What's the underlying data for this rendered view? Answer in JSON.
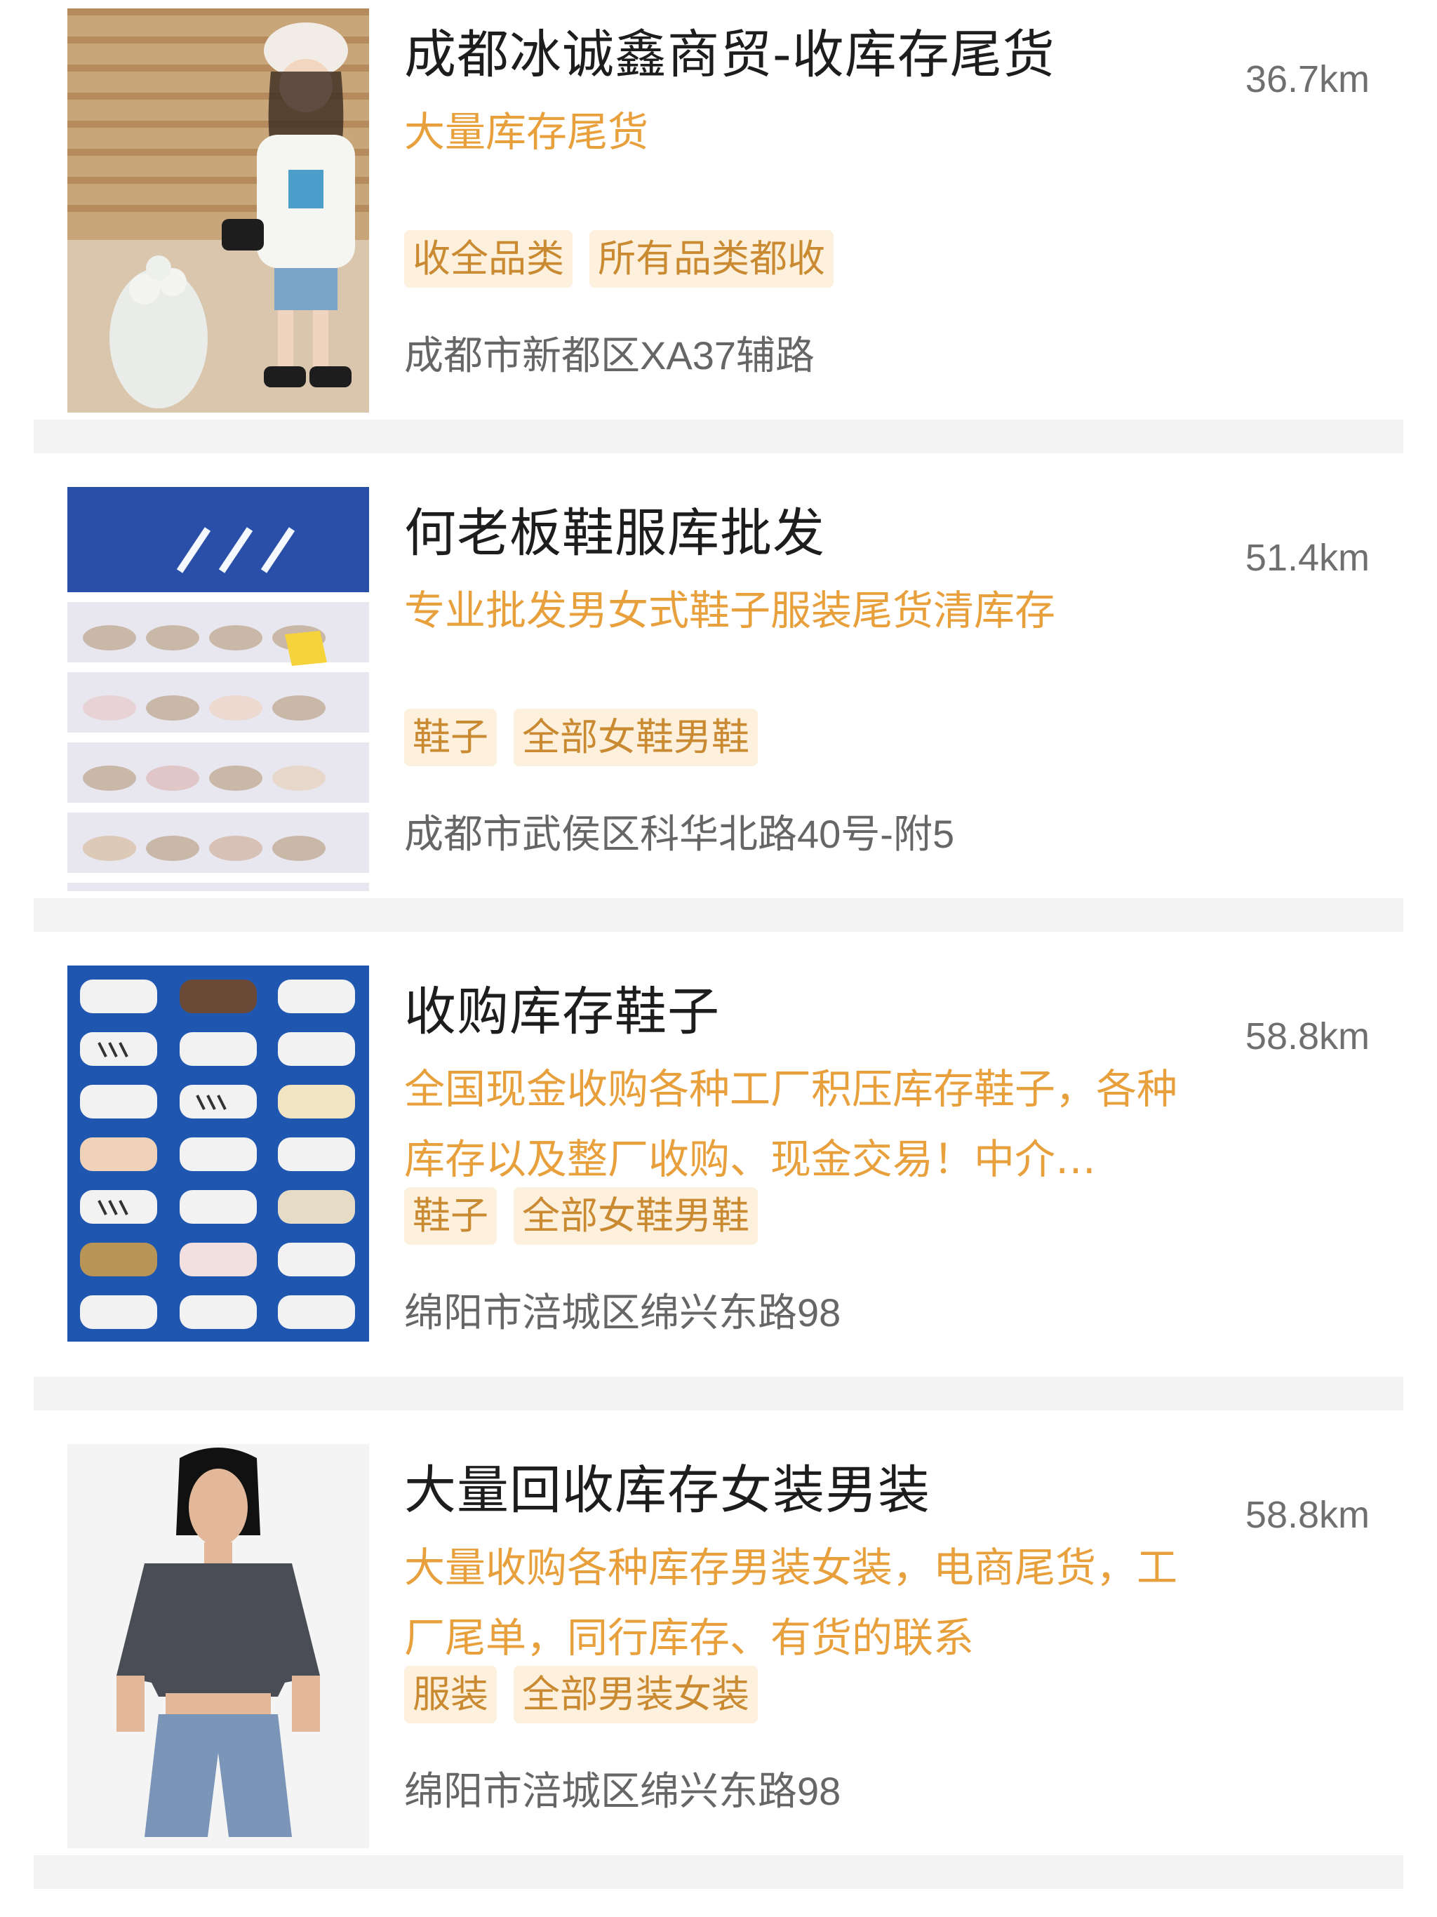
{
  "listings": [
    {
      "title": "成都冰诚鑫商贸-收库存尾货",
      "distance": "36.7km",
      "description": "大量库存尾货",
      "tags": [
        "收全品类",
        "所有品类都收"
      ],
      "address": "成都市新都区XA37辅路",
      "image": "girl-with-flowers-photo"
    },
    {
      "title": "何老板鞋服库批发",
      "distance": "51.4km",
      "description": "专业批发男女式鞋子服装尾货清库存",
      "tags": [
        "鞋子",
        "全部女鞋男鞋"
      ],
      "address": "成都市武侯区科华北路40号-附5",
      "image": "shoe-shelves-photo"
    },
    {
      "title": "收购库存鞋子",
      "distance": "58.8km",
      "description": "全国现金收购各种工厂积压库存鞋子，各种库存以及整厂收购、现金交易！中介…",
      "tags": [
        "鞋子",
        "全部女鞋男鞋"
      ],
      "address": "绵阳市涪城区绵兴东路98",
      "image": "sneaker-wall-photo"
    },
    {
      "title": "大量回收库存女装男装",
      "distance": "58.8km",
      "description": "大量收购各种库存男装女装，电商尾货，工厂尾单，同行库存、有货的联系",
      "tags": [
        "服装",
        "全部男装女装"
      ],
      "address": "绵阳市涪城区绵兴东路98",
      "image": "woman-in-denim-photo"
    }
  ],
  "colors": {
    "title": "#1d1d1d",
    "description": "#e8a03c",
    "tag_bg": "#fdf0dc",
    "tag_text": "#c98a32",
    "address": "#666666",
    "distance": "#6f6f6f",
    "divider": "#f3f3f3"
  }
}
